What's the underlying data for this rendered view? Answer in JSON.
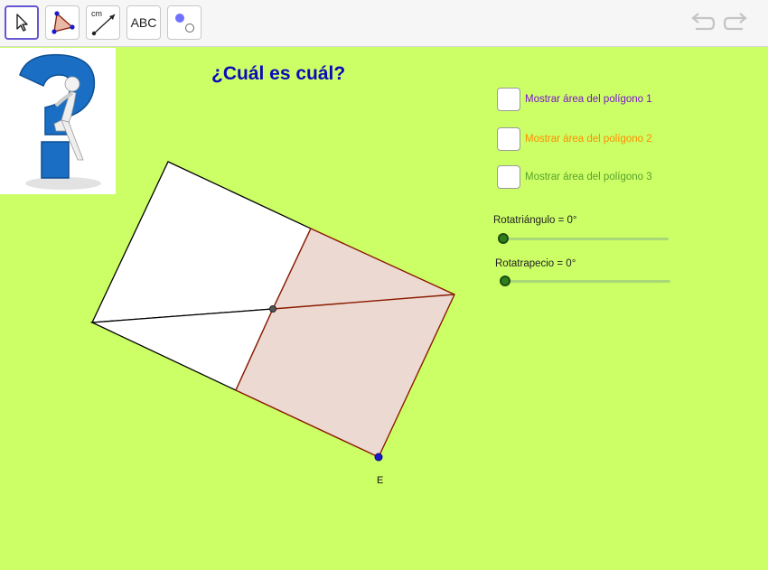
{
  "toolbar": {
    "measure_tool_label": "cm",
    "text_tool_label": "ABC"
  },
  "canvas": {
    "title": "¿Cuál es cuál?",
    "point_label": "E"
  },
  "checkboxes": [
    {
      "label": "Mostrar área del polígono 1",
      "checked": false,
      "color": "#7a16c9"
    },
    {
      "label": "Mostrar área del polígono 2",
      "checked": false,
      "color": "#ff8c00"
    },
    {
      "label": "Mostrar área del polígono 3",
      "checked": false,
      "color": "#5aa02c"
    }
  ],
  "sliders": [
    {
      "label": "Rotatriángulo = 0°",
      "value_deg": 0
    },
    {
      "label": "Rotatrapecio = 0°",
      "value_deg": 0
    }
  ],
  "colors": {
    "canvas_bg": "#ccff66",
    "title": "#0b0bb8",
    "shaded_polygon_fill": "#ecd9d2",
    "shaded_polygon_stroke": "#8b1a00",
    "point_blue": "#1a1acc"
  },
  "icons": {
    "move": "cursor-arrow-icon",
    "polygon": "polygon-icon",
    "distance": "distance-icon",
    "text": "text-icon",
    "style": "point-style-icon",
    "undo": "undo-icon",
    "redo": "redo-icon"
  }
}
